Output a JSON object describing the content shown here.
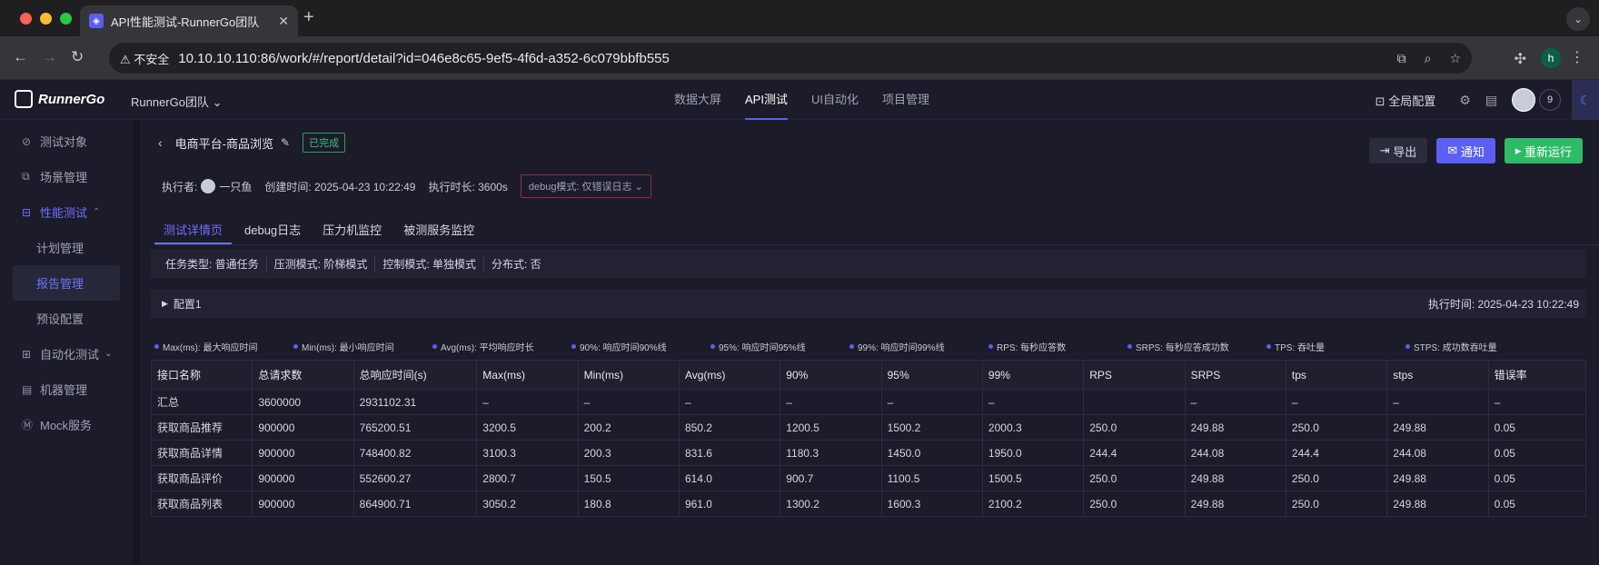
{
  "browser": {
    "tab_title": "API性能测试-RunnerGo团队",
    "security_label": "不安全",
    "url": "10.10.10.110:86/work/#/report/detail?id=046e8c65-9ef5-4f6d-a352-6c079bbfb555",
    "profile_initial": "h"
  },
  "header": {
    "logo": "RunnerGo",
    "team": "RunnerGo团队",
    "nav": [
      "数据大屏",
      "API测试",
      "UI自动化",
      "项目管理"
    ],
    "global_config": "全局配置",
    "member_count": "9"
  },
  "sidebar": {
    "items": [
      {
        "label": "测试对象"
      },
      {
        "label": "场景管理"
      },
      {
        "label": "性能测试"
      },
      {
        "label": "计划管理"
      },
      {
        "label": "报告管理"
      },
      {
        "label": "预设配置"
      },
      {
        "label": "自动化测试"
      },
      {
        "label": "机器管理"
      },
      {
        "label": "Mock服务"
      }
    ]
  },
  "report": {
    "title": "电商平台-商品浏览",
    "status": "已完成",
    "export": "导出",
    "notify": "通知",
    "rerun": "重新运行",
    "executor_label": "执行者:",
    "executor": "一只鱼",
    "created": "创建时间: 2025-04-23 10:22:49",
    "duration": "执行时长: 3600s",
    "debug_mode": "debug模式: 仅错误日志"
  },
  "tabs": [
    "测试详情页",
    "debug日志",
    "压力机监控",
    "被测服务监控"
  ],
  "info": [
    "任务类型: 普通任务",
    "压测模式: 阶梯模式",
    "控制模式: 单独模式",
    "分布式: 否"
  ],
  "config": {
    "name": "配置1",
    "exec_time": "执行时间: 2025-04-23 10:22:49"
  },
  "legend": [
    "Max(ms): 最大响应时间",
    "Min(ms): 最小响应时间",
    "Avg(ms): 平均响应时长",
    "90%: 响应时间90%线",
    "95%: 响应时间95%线",
    "99%: 响应时间99%线",
    "RPS: 每秒应答数",
    "SRPS: 每秒应答成功数",
    "TPS: 吞吐量",
    "STPS: 成功数吞吐量"
  ],
  "table": {
    "headers": [
      "接口名称",
      "总请求数",
      "总响应时间(s)",
      "Max(ms)",
      "Min(ms)",
      "Avg(ms)",
      "90%",
      "95%",
      "99%",
      "RPS",
      "SRPS",
      "tps",
      "stps",
      "错误率"
    ],
    "rows": [
      [
        "汇总",
        "3600000",
        "2931102.31",
        "–",
        "–",
        "–",
        "–",
        "–",
        "–",
        "",
        "–",
        "–",
        "–",
        "–"
      ],
      [
        "获取商品推荐",
        "900000",
        "765200.51",
        "3200.5",
        "200.2",
        "850.2",
        "1200.5",
        "1500.2",
        "2000.3",
        "250.0",
        "249.88",
        "250.0",
        "249.88",
        "0.05"
      ],
      [
        "获取商品详情",
        "900000",
        "748400.82",
        "3100.3",
        "200.3",
        "831.6",
        "1180.3",
        "1450.0",
        "1950.0",
        "244.4",
        "244.08",
        "244.4",
        "244.08",
        "0.05"
      ],
      [
        "获取商品评价",
        "900000",
        "552600.27",
        "2800.7",
        "150.5",
        "614.0",
        "900.7",
        "1100.5",
        "1500.5",
        "250.0",
        "249.88",
        "250.0",
        "249.88",
        "0.05"
      ],
      [
        "获取商品列表",
        "900000",
        "864900.71",
        "3050.2",
        "180.8",
        "961.0",
        "1300.2",
        "1600.3",
        "2100.2",
        "250.0",
        "249.88",
        "250.0",
        "249.88",
        "0.05"
      ]
    ]
  }
}
